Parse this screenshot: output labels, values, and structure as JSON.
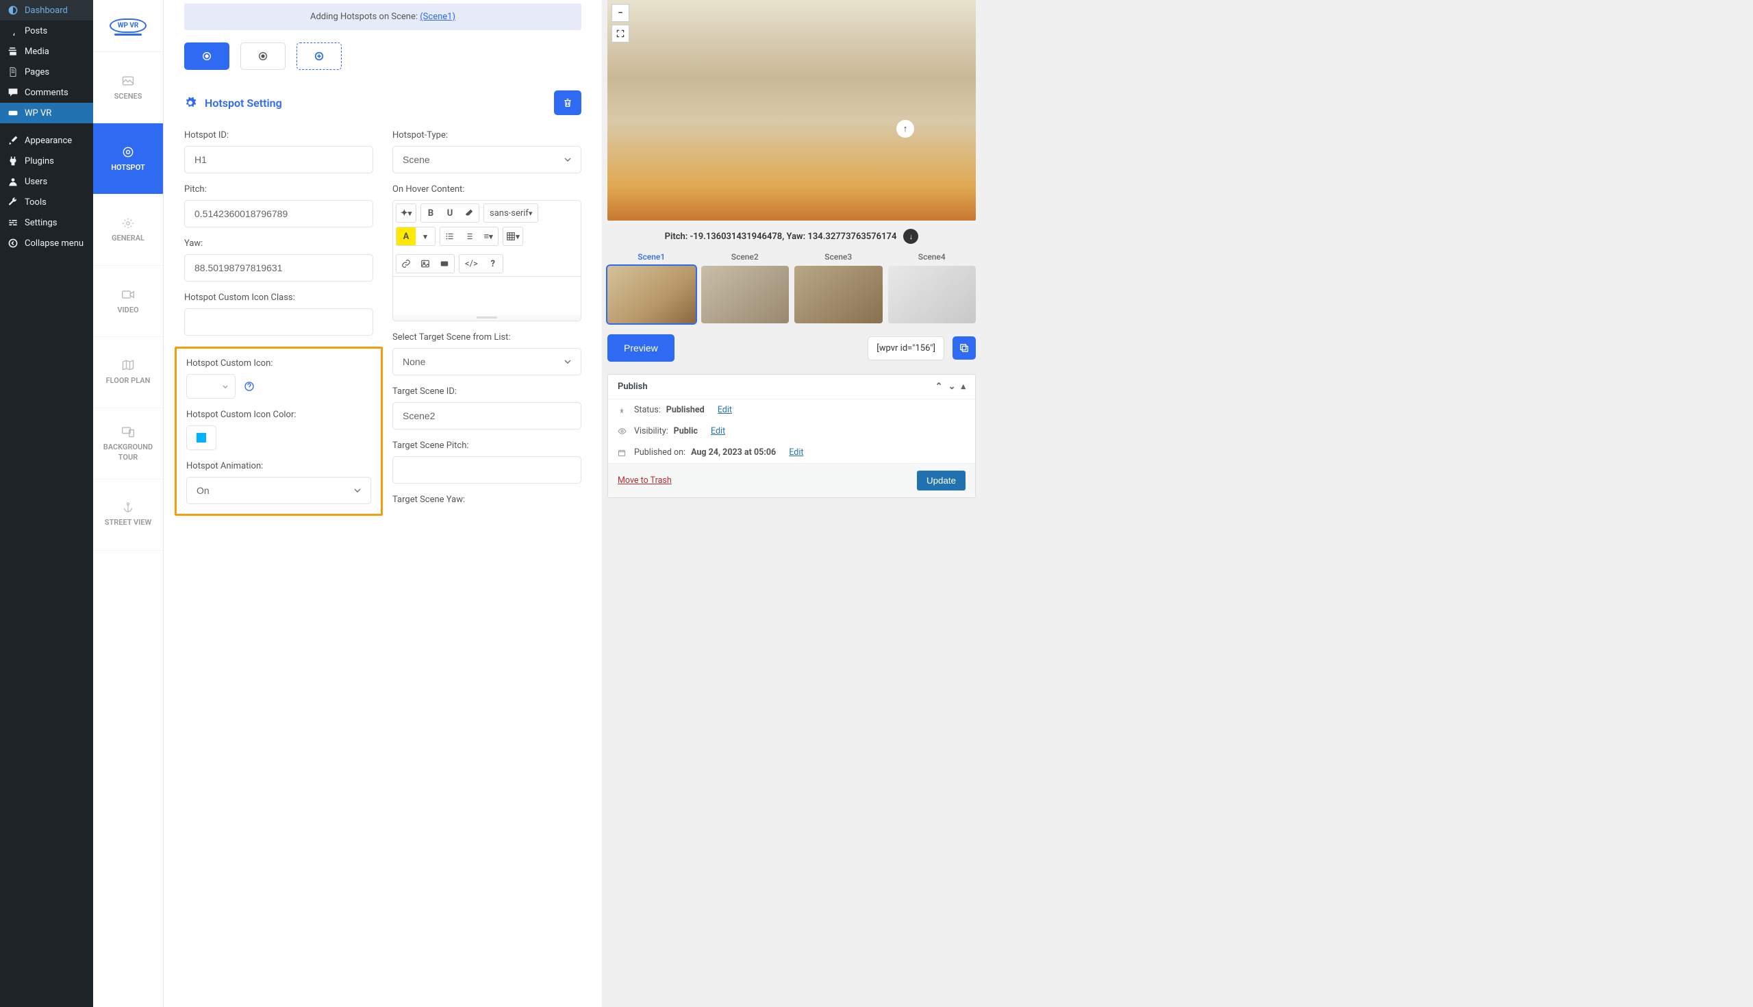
{
  "admin_menu": {
    "dashboard": "Dashboard",
    "posts": "Posts",
    "media": "Media",
    "pages": "Pages",
    "comments": "Comments",
    "wpvr": "WP VR",
    "appearance": "Appearance",
    "plugins": "Plugins",
    "users": "Users",
    "tools": "Tools",
    "settings": "Settings",
    "collapse": "Collapse menu"
  },
  "vt": {
    "logo": "WP VR",
    "scenes": "SCENES",
    "hotspot": "HOTSPOT",
    "general": "GENERAL",
    "video": "VIDEO",
    "floor_plan": "FLOOR PLAN",
    "bg_tour": "BACKGROUND TOUR",
    "street": "STREET VIEW"
  },
  "header": {
    "prefix": "Adding Hotspots on Scene: ",
    "scene": "(Scene1)"
  },
  "setting": {
    "title": "Hotspot Setting"
  },
  "left": {
    "hotspot_id_label": "Hotspot ID:",
    "hotspot_id_value": "H1",
    "pitch_label": "Pitch:",
    "pitch_value": "0.5142360018796789",
    "yaw_label": "Yaw:",
    "yaw_value": "88.50198797819631",
    "icon_class_label": "Hotspot Custom Icon Class:",
    "icon_class_value": "",
    "custom_icon_label": "Hotspot Custom Icon:",
    "color_label": "Hotspot Custom Icon Color:",
    "anim_label": "Hotspot Animation:",
    "anim_value": "On"
  },
  "right": {
    "type_label": "Hotspot-Type:",
    "type_value": "Scene",
    "hover_label": "On Hover Content:",
    "target_list_label": "Select Target Scene from List:",
    "target_list_value": "None",
    "target_id_label": "Target Scene ID:",
    "target_id_value": "Scene2",
    "target_pitch_label": "Target Scene Pitch:",
    "target_pitch_value": "",
    "target_yaw_label": "Target Scene Yaw:"
  },
  "rte": {
    "font": "sans-serif"
  },
  "preview": {
    "coords": "Pitch: -19.136031431946478, Yaw: 134.32773763576174",
    "scene1": "Scene1",
    "scene2": "Scene2",
    "scene3": "Scene3",
    "scene4": "Scene4",
    "preview_btn": "Preview",
    "shortcode": "[wpvr id=\"156\"]"
  },
  "publish": {
    "heading": "Publish",
    "status_label": "Status: ",
    "status_value": "Published",
    "visibility_label": "Visibility: ",
    "visibility_value": "Public",
    "pub_on_label": "Published on: ",
    "pub_on_value": "Aug 24, 2023 at 05:06",
    "edit": "Edit",
    "trash": "Move to Trash",
    "update": "Update"
  }
}
